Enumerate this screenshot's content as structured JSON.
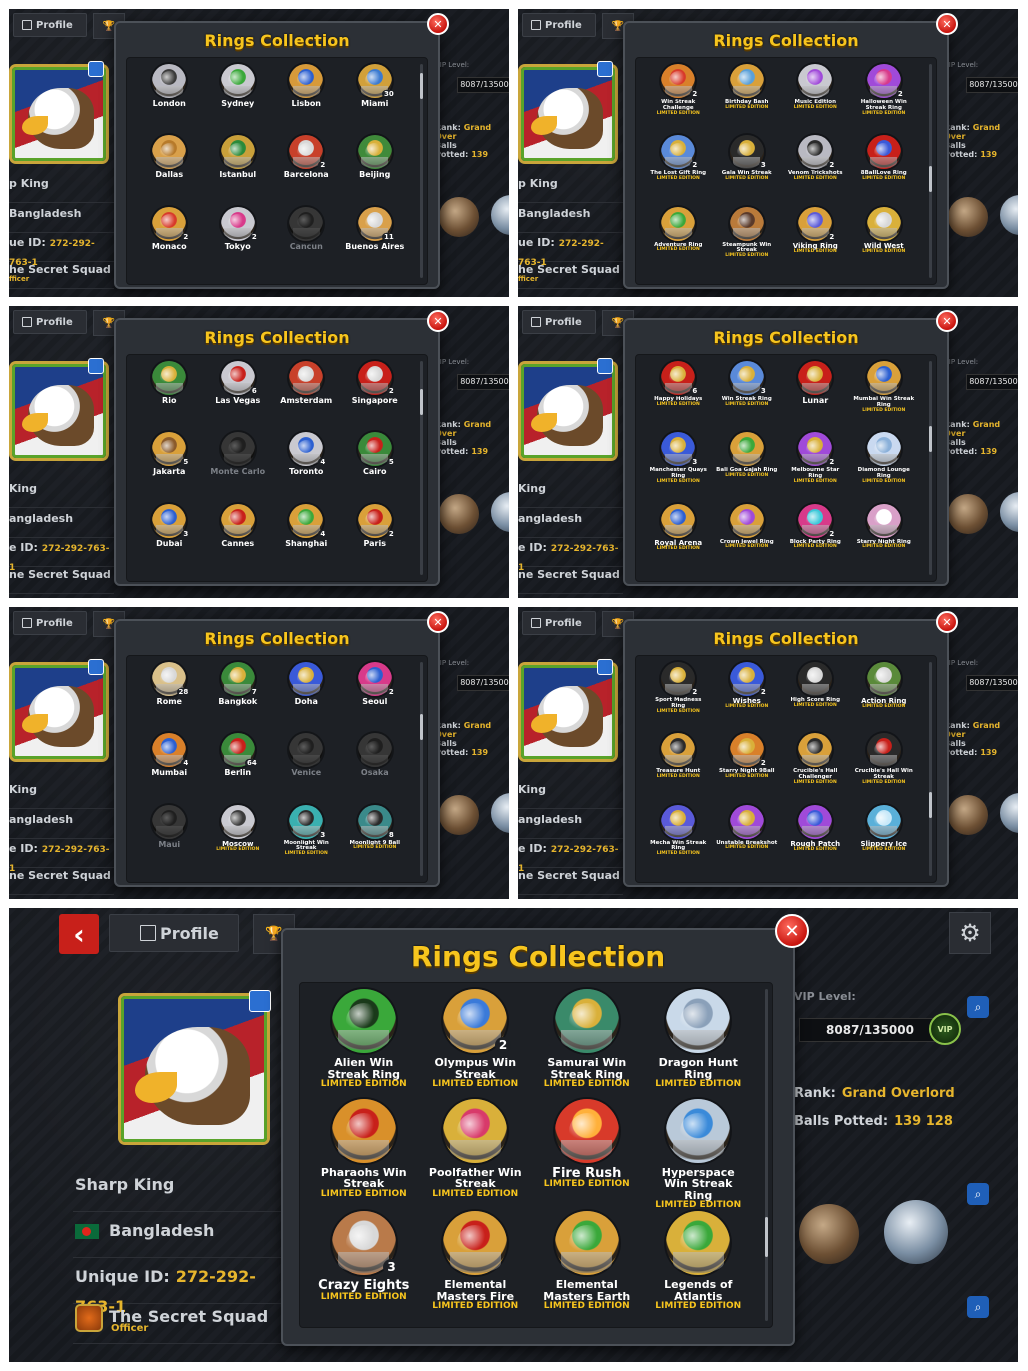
{
  "tab_profile": "Profile",
  "popup_title": "Rings Collection",
  "close_icon": "✕",
  "limited": "LIMITED EDITION",
  "profile": {
    "name": "Sharp King",
    "country": "Bangladesh",
    "uid_label": "Unique ID:",
    "uid": "272-292-763-1",
    "club": "The Secret Squad",
    "club_role": "Officer",
    "vip_label": "VIP Level:",
    "vip_value": "8087/135000",
    "vip_badge": "VIP",
    "rank_label": "Rank:",
    "rank": "Grand Overlord",
    "balls_label": "Balls Potted:",
    "balls": "139 128"
  },
  "crop": {
    "name": "p King",
    "country": "Bangladesh",
    "uid_label": "ue ID:",
    "uid": "272-292-763-1",
    "club": "he Secret Squad",
    "club_role": "fficer",
    "rank": "Grand Over",
    "balls": "139",
    "name2": "King",
    "country2": "angladesh",
    "uid_label2": "e ID:",
    "club2": "ne Secret Squad"
  },
  "panels": [
    {
      "rings": [
        {
          "name": "London",
          "color": "#b9b9c2",
          "gem": "#3a3a3a"
        },
        {
          "name": "Sydney",
          "color": "#c9c9d0",
          "gem": "#3aa83a"
        },
        {
          "name": "Lisbon",
          "color": "#d79a3a",
          "gem": "#2b5fd1"
        },
        {
          "name": "Miami",
          "color": "#d1a03a",
          "gem": "#3a7ad1",
          "count": "30"
        },
        {
          "name": "Dallas",
          "color": "#d9a04a",
          "gem": "#b77a2a"
        },
        {
          "name": "Istanbul",
          "color": "#c9a03a",
          "gem": "#2a8a3a"
        },
        {
          "name": "Barcelona",
          "color": "#c8402a",
          "gem": "#d8d8d8",
          "count": "2"
        },
        {
          "name": "Beijing",
          "color": "#3f8a3a",
          "gem": "#d9b03a"
        },
        {
          "name": "Monaco",
          "color": "#d9a03a",
          "gem": "#d83a2a",
          "count": "2"
        },
        {
          "name": "Tokyo",
          "color": "#c9c9d0",
          "gem": "#d83a8a",
          "count": "2"
        },
        {
          "name": "Cancun",
          "color": "#777777",
          "gem": "#444444",
          "locked": true
        },
        {
          "name": "Buenos Aires",
          "color": "#d9a04a",
          "gem": "#d8d8d8",
          "count": "11"
        }
      ]
    },
    {
      "rings": [
        {
          "name": "Win Streak Challenge",
          "color": "#d9802a",
          "gem": "#d83a2a",
          "count": "2",
          "ltd": true
        },
        {
          "name": "Birthday Bash",
          "color": "#d9a03a",
          "gem": "#5aa0d9",
          "ltd": true
        },
        {
          "name": "Music Edition",
          "color": "#c9c9d0",
          "gem": "#a04ad9",
          "ltd": true
        },
        {
          "name": "Halloween Win Streak Ring",
          "color": "#a04ad9",
          "gem": "#d83a8a",
          "count": "2",
          "ltd": true
        },
        {
          "name": "The Lost Gift Ring",
          "color": "#5a8ad9",
          "gem": "#d9b03a",
          "count": "2",
          "ltd": true
        },
        {
          "name": "Gala Win Streak",
          "color": "#2a2a2a",
          "gem": "#d9b03a",
          "count": "3",
          "ltd": true
        },
        {
          "name": "Venom Trickshots",
          "color": "#b9b9c2",
          "gem": "#2a2a2a",
          "count": "2",
          "ltd": true
        },
        {
          "name": "8BallLove Ring",
          "color": "#c8201a",
          "gem": "#3a5ad9",
          "ltd": true
        },
        {
          "name": "Adventure Ring",
          "color": "#d9a03a",
          "gem": "#3aa83a",
          "ltd": true
        },
        {
          "name": "Steampunk Win Streak",
          "color": "#b97a3a",
          "gem": "#5a3a2a",
          "ltd": true
        },
        {
          "name": "Viking Ring",
          "color": "#d9a03a",
          "gem": "#5a5ad9",
          "count": "2",
          "ltd": true
        },
        {
          "name": "Wild West",
          "color": "#d9b03a",
          "gem": "#d8d8d8",
          "ltd": true
        }
      ]
    },
    {
      "rings": [
        {
          "name": "Rio",
          "color": "#3a8a3a",
          "gem": "#d9b03a"
        },
        {
          "name": "Las Vegas",
          "color": "#c9c9d0",
          "gem": "#c8201a",
          "count": "6"
        },
        {
          "name": "Amsterdam",
          "color": "#c8402a",
          "gem": "#d8d8d8"
        },
        {
          "name": "Singapore",
          "color": "#c8201a",
          "gem": "#d8d8d8",
          "count": "2"
        },
        {
          "name": "Jakarta",
          "color": "#d9a03a",
          "gem": "#8a5a2a",
          "count": "5"
        },
        {
          "name": "Monte Carlo",
          "color": "#777777",
          "gem": "#444444",
          "locked": true
        },
        {
          "name": "Toronto",
          "color": "#c9c9d0",
          "gem": "#2b5fd1",
          "count": "4"
        },
        {
          "name": "Cairo",
          "color": "#3a8a3a",
          "gem": "#c8201a",
          "count": "5"
        },
        {
          "name": "Dubai",
          "color": "#d9a03a",
          "gem": "#2b5fd1",
          "count": "3"
        },
        {
          "name": "Cannes",
          "color": "#d9a03a",
          "gem": "#c8201a"
        },
        {
          "name": "Shanghai",
          "color": "#d9a03a",
          "gem": "#3aa83a",
          "count": "4"
        },
        {
          "name": "Paris",
          "color": "#d9a03a",
          "gem": "#c8201a",
          "count": "2"
        }
      ]
    },
    {
      "rings": [
        {
          "name": "Happy Holidays",
          "color": "#c8201a",
          "gem": "#d9b03a",
          "count": "6",
          "ltd": true
        },
        {
          "name": "Win Streak Ring",
          "color": "#5a8ad9",
          "gem": "#d9b03a",
          "count": "3",
          "ltd": true
        },
        {
          "name": "Lunar",
          "color": "#c8201a",
          "gem": "#d9b03a"
        },
        {
          "name": "Mumbai Win Streak Ring",
          "color": "#d9a03a",
          "gem": "#2b5fd1",
          "ltd": true
        },
        {
          "name": "Manchester Quays Ring",
          "color": "#3a5ad9",
          "gem": "#d9b03a",
          "count": "3",
          "ltd": true
        },
        {
          "name": "Bali Goa Gajah Ring",
          "color": "#d9a03a",
          "gem": "#3aa83a",
          "ltd": true
        },
        {
          "name": "Melbourne Star Ring",
          "color": "#a04ad9",
          "gem": "#d9b03a",
          "count": "2",
          "ltd": true
        },
        {
          "name": "Diamond Lounge Ring",
          "color": "#c9d9f0",
          "gem": "#8ab0d9",
          "ltd": true
        },
        {
          "name": "Royal Arena",
          "color": "#d9a03a",
          "gem": "#2b5fd1",
          "ltd": true
        },
        {
          "name": "Crown Jewel Ring",
          "color": "#d9a03a",
          "gem": "#a04ad9",
          "ltd": true
        },
        {
          "name": "Block Party Ring",
          "color": "#d83a8a",
          "gem": "#3ac8d9",
          "count": "2",
          "ltd": true
        },
        {
          "name": "Starry Night Ring",
          "color": "#d9a0c8",
          "gem": "#ffffff",
          "ltd": true
        }
      ]
    },
    {
      "rings": [
        {
          "name": "Rome",
          "color": "#d9c08a",
          "gem": "#d8d8d8",
          "count": "28"
        },
        {
          "name": "Bangkok",
          "color": "#3a8a3a",
          "gem": "#d9b03a",
          "count": "7"
        },
        {
          "name": "Doha",
          "color": "#3a5ad9",
          "gem": "#d9b03a"
        },
        {
          "name": "Seoul",
          "color": "#d83a8a",
          "gem": "#2b5fd1",
          "count": "2"
        },
        {
          "name": "Mumbai",
          "color": "#d9802a",
          "gem": "#2b5fd1",
          "count": "4"
        },
        {
          "name": "Berlin",
          "color": "#3a8a3a",
          "gem": "#c8201a",
          "count": "64"
        },
        {
          "name": "Venice",
          "color": "#777777",
          "gem": "#444444",
          "locked": true
        },
        {
          "name": "Osaka",
          "color": "#777777",
          "gem": "#444444",
          "locked": true
        },
        {
          "name": "Maui",
          "color": "#777777",
          "gem": "#444444",
          "locked": true
        },
        {
          "name": "Moscow",
          "color": "#c9c9d0",
          "gem": "#3a3a3a",
          "ltd": true
        },
        {
          "name": "Moonlight Win Streak",
          "color": "#3ab0b0",
          "gem": "#2a2a2a",
          "count": "3",
          "ltd": true
        },
        {
          "name": "Moonlight 9 Ball",
          "color": "#3a8a8a",
          "gem": "#2a2a2a",
          "count": "8",
          "ltd": true
        }
      ]
    },
    {
      "rings": [
        {
          "name": "Sport Madness Ring",
          "color": "#2a2a2a",
          "gem": "#d9b03a",
          "count": "2",
          "ltd": true
        },
        {
          "name": "Wishes",
          "color": "#3a5ad9",
          "gem": "#d9b03a",
          "count": "2",
          "ltd": true
        },
        {
          "name": "High Score Ring",
          "color": "#2a2a2a",
          "gem": "#d8d8d8",
          "ltd": true
        },
        {
          "name": "Action Ring",
          "color": "#5a8a3a",
          "gem": "#d8d8d8",
          "ltd": true
        },
        {
          "name": "Treasure Hunt",
          "color": "#d9a03a",
          "gem": "#2a2a2a",
          "ltd": true
        },
        {
          "name": "Starry Night 9Ball",
          "color": "#d9802a",
          "gem": "#d9b03a",
          "count": "2",
          "ltd": true
        },
        {
          "name": "Crucible's Hall Challenger",
          "color": "#d9a03a",
          "gem": "#2a2a2a",
          "ltd": true
        },
        {
          "name": "Crucible's Hall Win Streak",
          "color": "#2a2a2a",
          "gem": "#c8201a",
          "ltd": true
        },
        {
          "name": "Mecha Win Streak Ring",
          "color": "#5a5ad9",
          "gem": "#d9b03a",
          "ltd": true
        },
        {
          "name": "Unstable Breakshot",
          "color": "#a04ad9",
          "gem": "#d9b03a",
          "ltd": true
        },
        {
          "name": "Rough Patch",
          "color": "#a04ad9",
          "gem": "#3a5ad9",
          "ltd": true
        },
        {
          "name": "Slippery Ice",
          "color": "#5ab0d9",
          "gem": "#c9e9f9",
          "ltd": true
        }
      ]
    },
    {
      "rings": [
        {
          "name": "Alien Win Streak Ring",
          "color": "#3aa83a",
          "gem": "#1a3a1a",
          "ltd": true
        },
        {
          "name": "Olympus Win Streak",
          "color": "#d9a03a",
          "gem": "#3a7ad9",
          "count": "2",
          "ltd": true
        },
        {
          "name": "Samurai Win Streak Ring",
          "color": "#3a8a6a",
          "gem": "#d9b03a",
          "ltd": true
        },
        {
          "name": "Dragon Hunt Ring",
          "color": "#c9d9e9",
          "gem": "#8aa0b9",
          "ltd": true
        },
        {
          "name": "Pharaohs Win Streak",
          "color": "#d9902a",
          "gem": "#c8201a",
          "ltd": true
        },
        {
          "name": "Poolfather Win Streak",
          "color": "#d9b03a",
          "gem": "#d83a6a",
          "ltd": true
        },
        {
          "name": "Fire Rush",
          "color": "#d83a2a",
          "gem": "#ffb03a",
          "ltd": true
        },
        {
          "name": "Hyperspace Win Streak Ring",
          "color": "#b9c9d9",
          "gem": "#3a8ad9",
          "ltd": true
        },
        {
          "name": "Crazy Eights",
          "color": "#b97a4a",
          "gem": "#d8d8d8",
          "count": "3",
          "ltd": true
        },
        {
          "name": "Elemental Masters Fire",
          "color": "#d9a03a",
          "gem": "#c8201a",
          "ltd": true
        },
        {
          "name": "Elemental Masters Earth",
          "color": "#d9a03a",
          "gem": "#3aa83a",
          "ltd": true
        },
        {
          "name": "Legends of Atlantis",
          "color": "#d9b03a",
          "gem": "#3aa83a",
          "ltd": true
        }
      ]
    }
  ]
}
